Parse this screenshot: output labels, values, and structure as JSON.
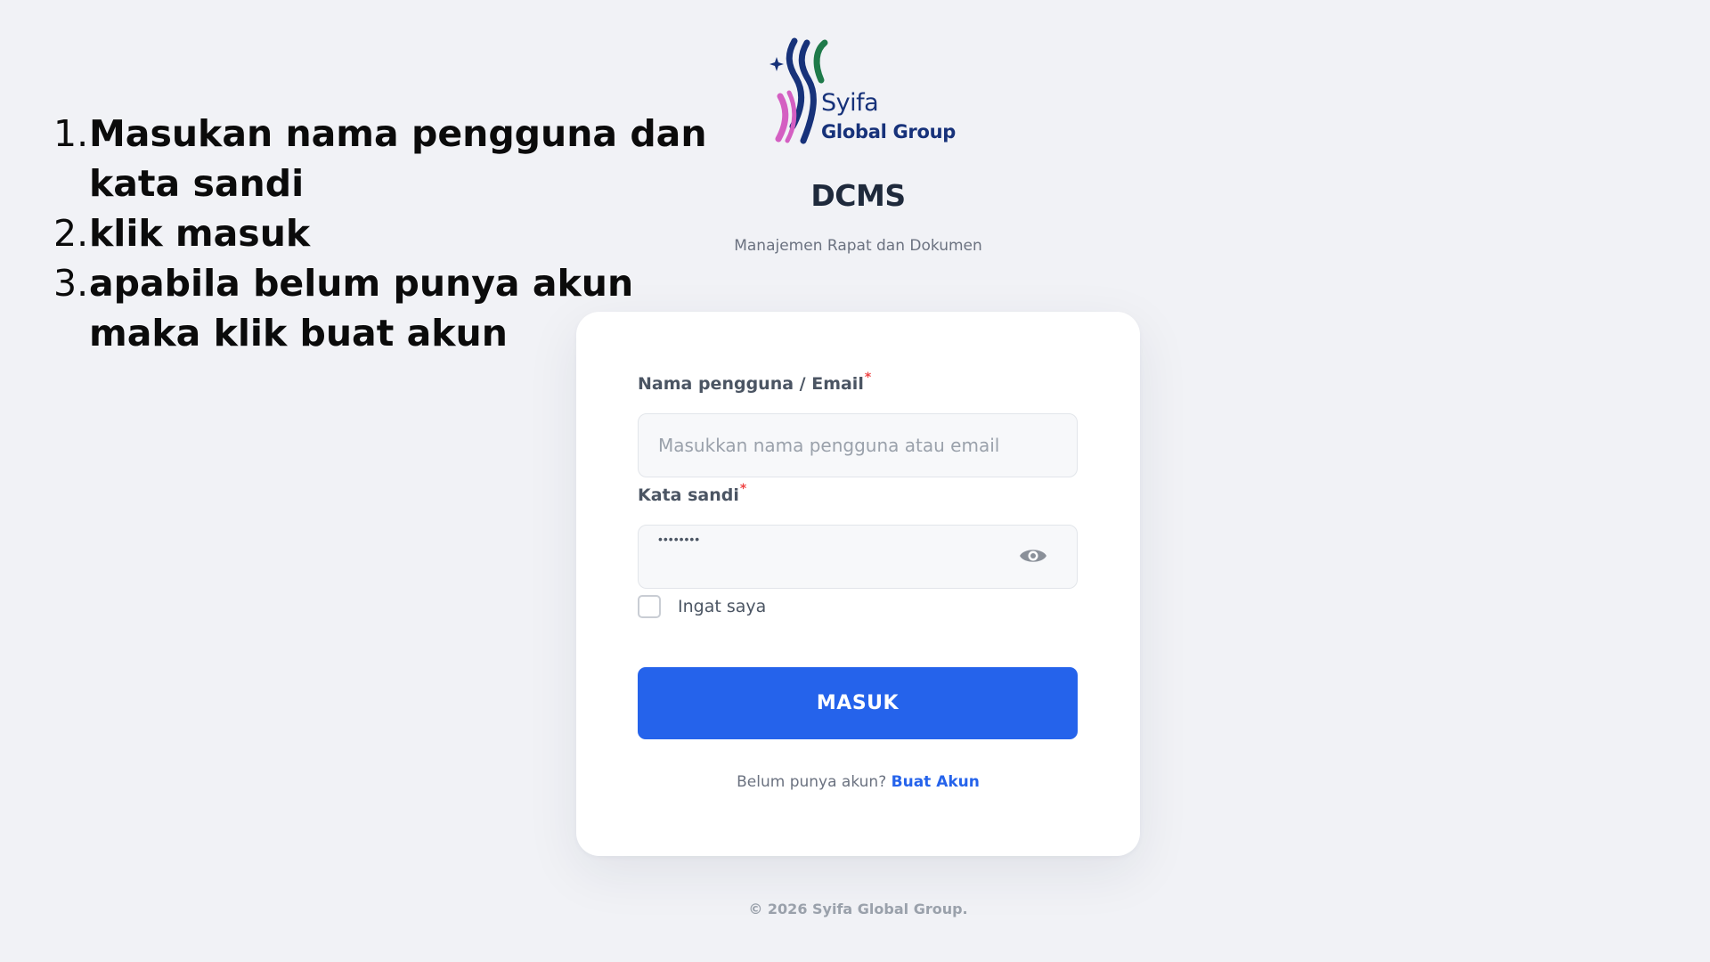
{
  "instructions": [
    {
      "num": "1.",
      "text": "Masukan nama pengguna dan kata sandi"
    },
    {
      "num": "2.",
      "text": "klik masuk"
    },
    {
      "num": "3.",
      "text": "apabila belum punya akun maka klik buat akun"
    }
  ],
  "brand": {
    "logo_line1": "Syifa",
    "logo_line2": "Global Group",
    "logo_icon": "syifa-logo",
    "colors": {
      "navy": "#17327a",
      "green": "#1f7a4a",
      "magenta": "#d45fc2"
    }
  },
  "app": {
    "title": "DCMS",
    "subtitle": "Manajemen Rapat dan Dokumen"
  },
  "form": {
    "username_label": "Nama pengguna / Email",
    "username_placeholder": "Masukkan nama pengguna atau email",
    "password_label": "Kata sandi",
    "password_masked": "••••••••",
    "required_marker": "*",
    "toggle_password_icon": "eye-icon",
    "remember_label": "Ingat saya",
    "submit_label": "MASUK",
    "register_prompt": "Belum punya akun?",
    "register_link": "Buat Akun"
  },
  "footer": {
    "copyright": "© 2026 Syifa Global Group."
  },
  "colors": {
    "background": "#f1f2f6",
    "card": "#ffffff",
    "primary": "#2563eb",
    "required": "#ef4444"
  }
}
